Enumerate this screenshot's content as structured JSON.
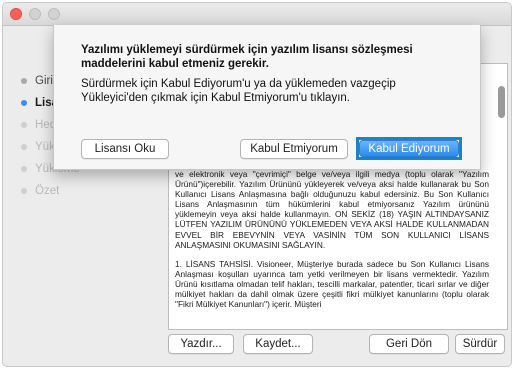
{
  "window": {
    "traffic_lights": {
      "close": "#fc605c",
      "minimize": "#d2d2d2",
      "zoom": "#d2d2d2"
    }
  },
  "sidebar": {
    "items": [
      {
        "label": "Giriş",
        "state": "done"
      },
      {
        "label": "Lisans",
        "state": "active"
      },
      {
        "label": "Hedef",
        "state": "pending"
      },
      {
        "label": "Yükleme Türü",
        "state": "pending"
      },
      {
        "label": "Yükleme",
        "state": "pending"
      },
      {
        "label": "Özet",
        "state": "pending"
      }
    ]
  },
  "license": {
    "paragraphs": [
      "ve elektronik veya \"çevrimiçi\" belge ve/veya ilgili medya (toplu olarak \"Yazılım Ürünü\")içerebilir.  Yazılım Ürününü yükleyerek ve/veya aksi halde kullanarak bu Son Kullanıcı Lisans Anlaşmasına bağlı olduğunuzu kabul edersiniz.  Bu Son Kullanıcı Lisans Anlaşmasının tüm hükümlerini kabul etmiyorsanız Yazılım ürününü yüklemeyin veya aksi halde kullanmayın.  ON SEKİZ (18) YAŞIN ALTINDAYSANIZ LÜTFEN YAZILIM ÜRÜNÜNÜ YÜKLEMEDEN VEYA AKSİ HALDE KULLANMADAN EVVEL BİR EBEVYNİN VEYA VASİNİN TÜM SON KULLANICI LİSANS ANLAŞMASINI OKUMASINI SAĞLAYIN.",
      "1.      LİSANS TAHSİSİ.  Visioneer, Müşteriye burada sadece bu Son Kullanıcı Lisans Anlaşması koşulları uyarınca tam yetki verilmeyen bir lisans vermektedir.  Yazılım Ürünü kısıtlama olmadan telif hakları, tescilli markalar, patentler, ticari sırlar ve diğer mülkiyet hakları da dahil olmak üzere çeşitli fikri mülkiyet kanunlarını (toplu olarak \"Fikri Mülkiyet Kanunları\") içerir.  Müşteri"
    ]
  },
  "buttons": {
    "print": "Yazdır...",
    "save": "Kaydet...",
    "back": "Geri Dön",
    "continue": "Sürdür"
  },
  "sheet": {
    "title": "Yazılımı yüklemeyi sürdürmek için yazılım lisansı sözleşmesi maddelerini kabul etmeniz gerekir.",
    "message": "Sürdürmek için Kabul Ediyorum'u ya da yüklemeden vazgeçip Yükleyici'den çıkmak için Kabul Etmiyorum'u tıklayın.",
    "read_license": "Lisansı Oku",
    "disagree": "Kabul Etmiyorum",
    "agree": "Kabul Ediyorum",
    "highlight_color": "#1f82c4"
  }
}
